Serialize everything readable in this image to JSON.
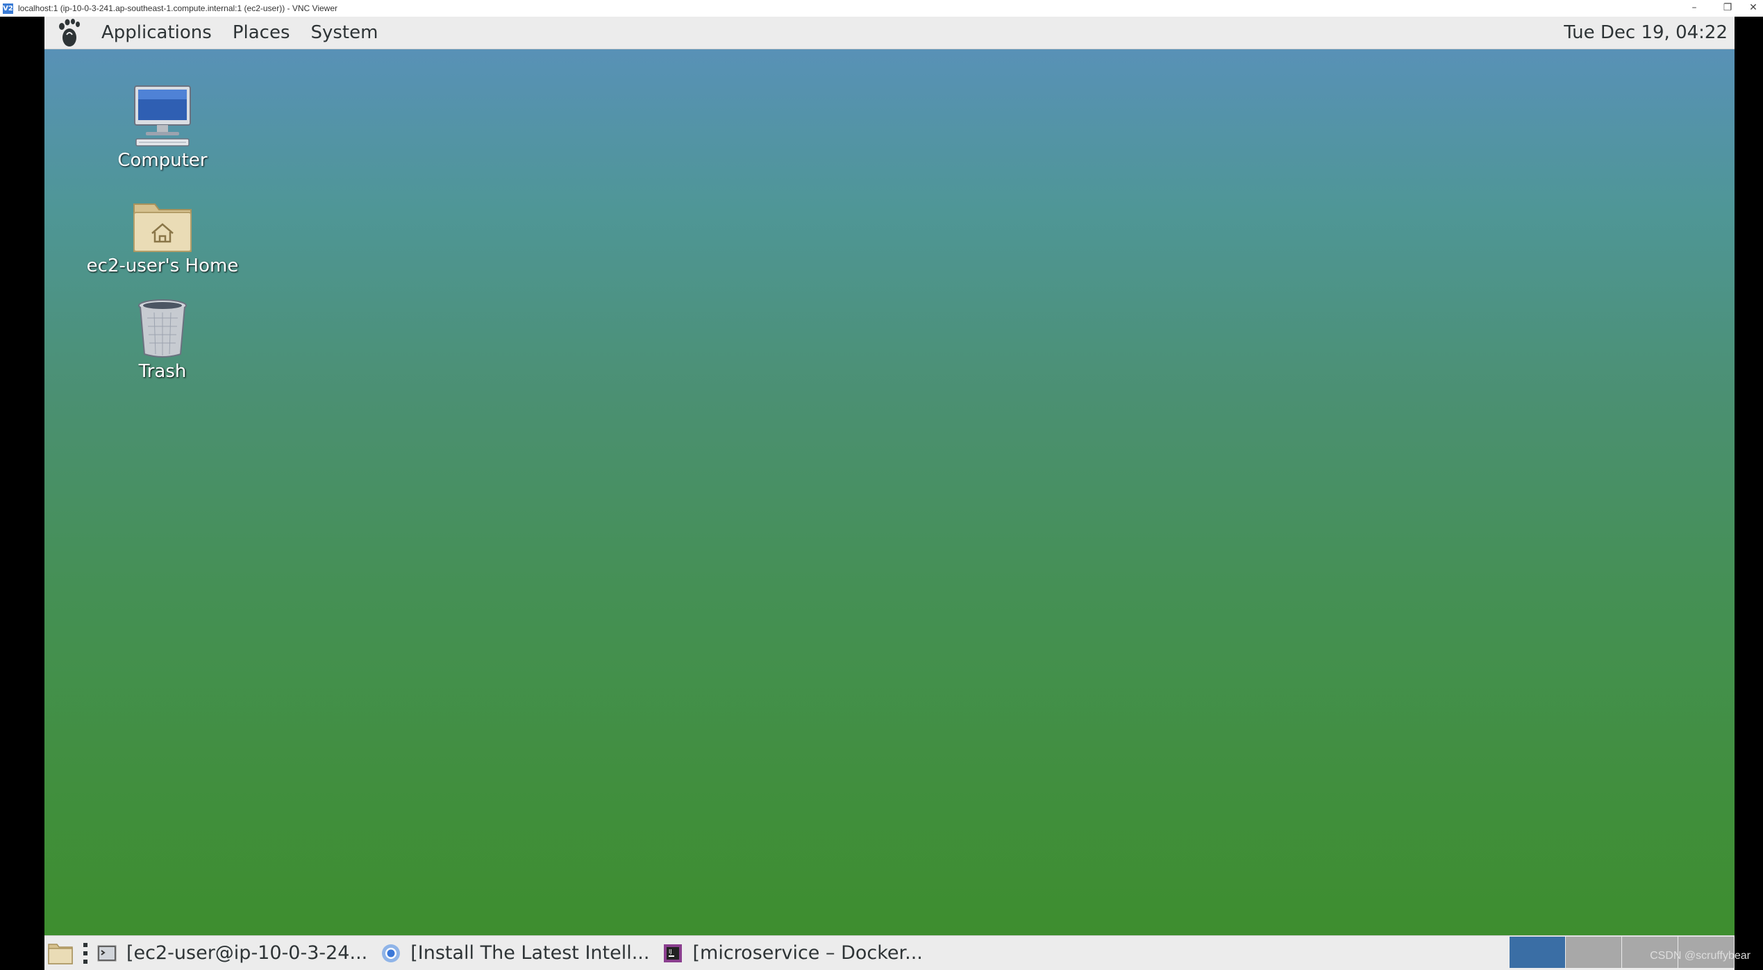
{
  "vnc_window": {
    "title": "localhost:1 (ip-10-0-3-241.ap-southeast-1.compute.internal:1 (ec2-user)) - VNC Viewer",
    "icon_label": "V2"
  },
  "top_panel": {
    "menus": [
      "Applications",
      "Places",
      "System"
    ],
    "clock": "Tue Dec 19, 04:22"
  },
  "desktop_icons": [
    {
      "label": "Computer",
      "icon": "computer-icon"
    },
    {
      "label": "ec2-user's Home",
      "icon": "home-folder-icon"
    },
    {
      "label": "Trash",
      "icon": "trash-icon"
    }
  ],
  "taskbar": {
    "tasks": [
      {
        "label": "[ec2-user@ip-10-0-3-24...",
        "icon": "terminal-icon"
      },
      {
        "label": "[Install The Latest Intell...",
        "icon": "chrome-icon"
      },
      {
        "label": "[microservice – Docker...",
        "icon": "intellij-icon"
      }
    ],
    "workspaces": 4,
    "active_workspace": 1
  },
  "watermark": "CSDN @scruffybear",
  "colors": {
    "panel": "#ececec",
    "desktop_top": "#5a90bd",
    "desktop_bottom": "#3d8e2b",
    "active_workspace": "#3a6ea5"
  }
}
